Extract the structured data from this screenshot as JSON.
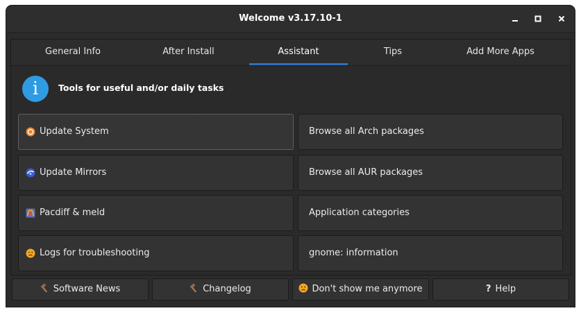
{
  "window": {
    "title": "Welcome v3.17.10-1",
    "controls": {
      "minimize": "minimize-icon",
      "maximize": "maximize-icon",
      "close": "close-icon"
    }
  },
  "tabs": [
    {
      "label": "General Info",
      "active": false
    },
    {
      "label": "After Install",
      "active": false
    },
    {
      "label": "Assistant",
      "active": true
    },
    {
      "label": "Tips",
      "active": false
    },
    {
      "label": "Add More Apps",
      "active": false
    }
  ],
  "assistant": {
    "heading_icon": "info-icon",
    "heading": "Tools for useful and/or daily tasks",
    "left_buttons": [
      {
        "label": "Update System",
        "icon": "update-system-icon",
        "focused": true
      },
      {
        "label": "Update Mirrors",
        "icon": "update-mirrors-icon",
        "focused": false
      },
      {
        "label": "Pacdiff & meld",
        "icon": "meld-icon",
        "focused": false
      },
      {
        "label": "Logs for troubleshooting",
        "icon": "sad-face-icon",
        "focused": false
      }
    ],
    "right_buttons": [
      {
        "label": "Browse all Arch packages"
      },
      {
        "label": "Browse all AUR packages"
      },
      {
        "label": "Application categories"
      },
      {
        "label": "gnome: information"
      }
    ]
  },
  "footer": {
    "buttons": [
      {
        "label": "Software News",
        "icon": "hammer-icon"
      },
      {
        "label": "Changelog",
        "icon": "hammer-icon"
      },
      {
        "label": "Don't show me anymore",
        "icon": "sad-face-icon"
      },
      {
        "label": "Help",
        "icon": "question-icon",
        "icon_glyph": "?"
      }
    ]
  },
  "colors": {
    "accent": "#2f6fc0",
    "info_icon": "#2f9be3",
    "window_bg": "#2b2b2b",
    "button_bg": "#333333",
    "text": "#ececec"
  }
}
